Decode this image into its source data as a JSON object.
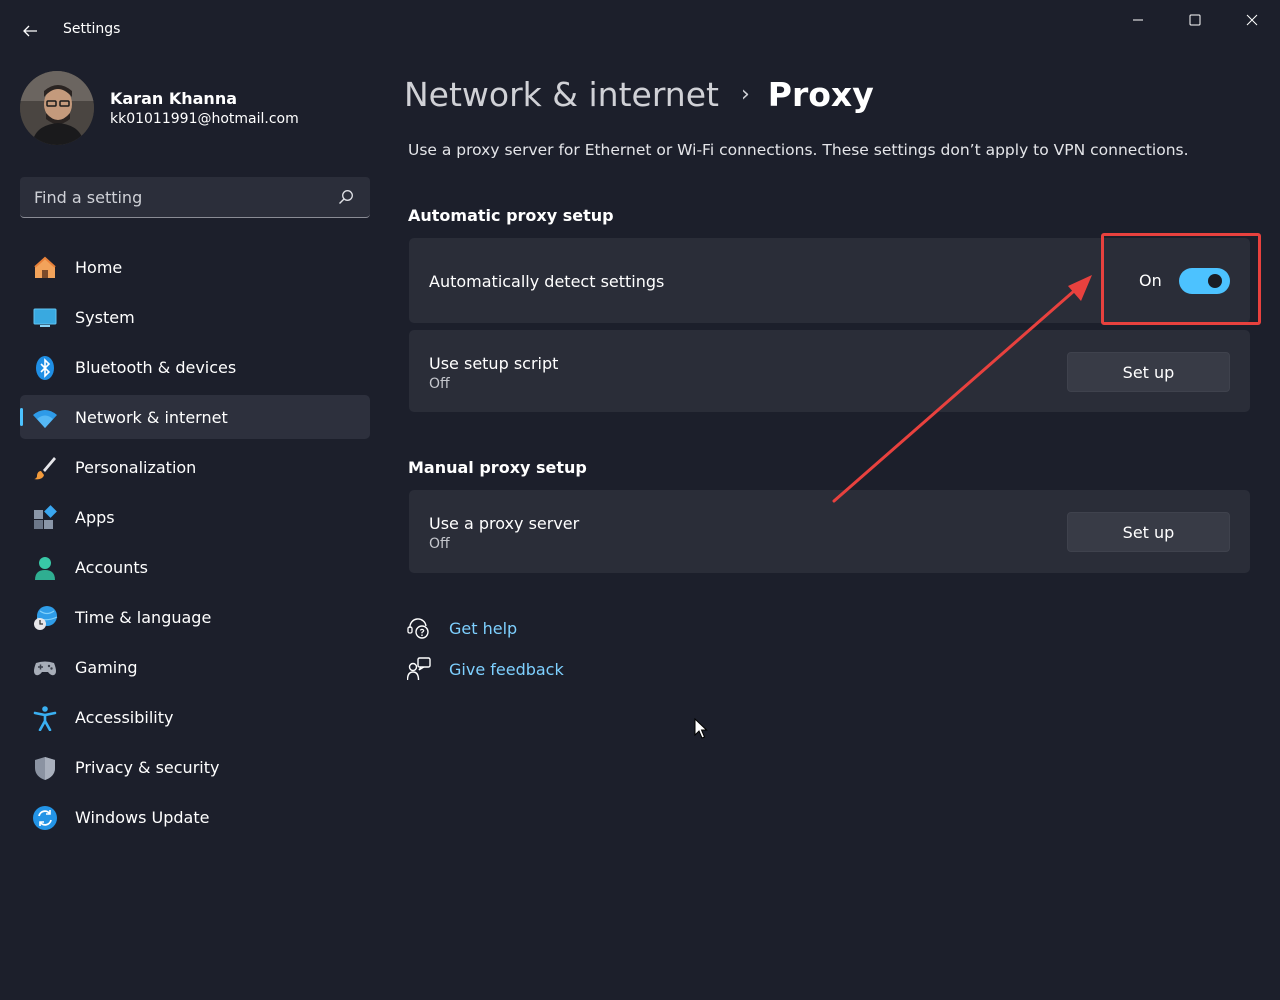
{
  "window": {
    "title": "Settings",
    "back_icon": "back-arrow-icon",
    "controls": [
      "minimize-icon",
      "maximize-icon",
      "close-icon"
    ]
  },
  "profile": {
    "name": "Karan Khanna",
    "email": "kk01011991@hotmail.com"
  },
  "search": {
    "placeholder": "Find a setting",
    "icon": "search-icon"
  },
  "nav": {
    "items": [
      {
        "label": "Home",
        "icon": "home-icon",
        "active": false
      },
      {
        "label": "System",
        "icon": "system-display-icon",
        "active": false
      },
      {
        "label": "Bluetooth & devices",
        "icon": "bluetooth-icon",
        "active": false
      },
      {
        "label": "Network & internet",
        "icon": "wifi-icon",
        "active": true
      },
      {
        "label": "Personalization",
        "icon": "paintbrush-icon",
        "active": false
      },
      {
        "label": "Apps",
        "icon": "apps-icon",
        "active": false
      },
      {
        "label": "Accounts",
        "icon": "person-icon",
        "active": false
      },
      {
        "label": "Time & language",
        "icon": "globe-clock-icon",
        "active": false
      },
      {
        "label": "Gaming",
        "icon": "gamepad-icon",
        "active": false
      },
      {
        "label": "Accessibility",
        "icon": "accessibility-icon",
        "active": false
      },
      {
        "label": "Privacy & security",
        "icon": "shield-icon",
        "active": false
      },
      {
        "label": "Windows Update",
        "icon": "update-icon",
        "active": false
      }
    ]
  },
  "breadcrumb": {
    "parent": "Network & internet",
    "separator": "›",
    "current": "Proxy"
  },
  "page": {
    "description": "Use a proxy server for Ethernet or Wi-Fi connections. These settings don’t apply to VPN connections."
  },
  "automatic": {
    "section_title": "Automatic proxy setup",
    "detect": {
      "label": "Automatically detect settings",
      "state_label": "On",
      "enabled": true
    },
    "script": {
      "label": "Use setup script",
      "status": "Off",
      "button_label": "Set up"
    }
  },
  "manual": {
    "section_title": "Manual proxy setup",
    "proxy_server": {
      "label": "Use a proxy server",
      "status": "Off",
      "button_label": "Set up"
    }
  },
  "links": {
    "help": {
      "label": "Get help",
      "icon": "help-icon"
    },
    "feedback": {
      "label": "Give feedback",
      "icon": "feedback-icon"
    }
  },
  "colors": {
    "accent": "#4cc2ff",
    "annotation": "#e8413e",
    "background": "#1c1f2b",
    "card": "#2a2d38"
  }
}
